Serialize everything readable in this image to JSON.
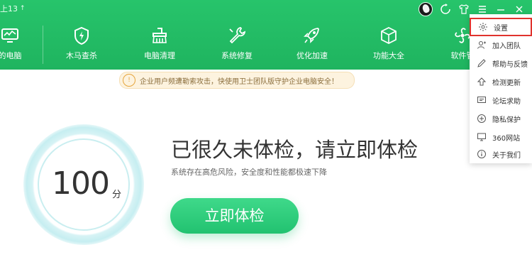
{
  "titlebar": {
    "status_text": "上13"
  },
  "nav": {
    "items": [
      {
        "label": "的电脑",
        "icon": "monitor-icon"
      },
      {
        "label": "木马查杀",
        "icon": "shield-bolt-icon"
      },
      {
        "label": "电脑清理",
        "icon": "broom-icon"
      },
      {
        "label": "系统修复",
        "icon": "wrench-icon"
      },
      {
        "label": "优化加速",
        "icon": "rocket-icon"
      },
      {
        "label": "功能大全",
        "icon": "cube-icon"
      },
      {
        "label": "软件管",
        "icon": "fan-icon"
      }
    ]
  },
  "notice": {
    "text": "企业用户频遭勒索攻击，快使用卫士团队版守护企业电脑安全！"
  },
  "score": {
    "value": "100",
    "unit": "分"
  },
  "headline": "已很久未体检，请立即体检",
  "subline": "系统存在高危风险，安全度和性能都极速下降",
  "scan_button": "立即体检",
  "menu": {
    "items": [
      {
        "label": "设置",
        "icon": "gear-icon",
        "highlighted": true
      },
      {
        "label": "加入团队",
        "icon": "user-icon"
      },
      {
        "label": "帮助与反馈",
        "icon": "pencil-icon"
      },
      {
        "label": "检测更新",
        "icon": "arrow-up-icon"
      },
      {
        "label": "论坛求助",
        "icon": "forum-icon"
      },
      {
        "label": "隐私保护",
        "icon": "plus-circle-icon"
      },
      {
        "label": "360网站",
        "icon": "display-icon"
      },
      {
        "label": "关于我们",
        "icon": "info-icon"
      }
    ]
  },
  "colors": {
    "brand_green": "#22c270",
    "highlight_red": "#e0332d"
  }
}
